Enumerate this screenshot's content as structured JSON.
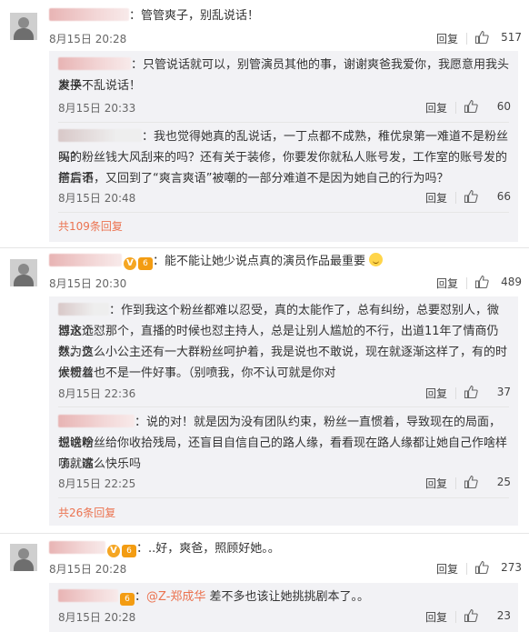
{
  "c1": {
    "text": "：管管爽子，别乱说话！",
    "time": "8月15日 20:28",
    "reply": "回复",
    "likes": "517",
    "replies": [
      {
        "lines": [
          "：只管说话就可以，别管演员其他的事，谢谢爽爸我爱你，我愿意用我头发换",
          "爽子不乱说话！"
        ],
        "time": "8月15日 20:33",
        "reply": "回复",
        "likes": "60"
      },
      {
        "lines": [
          "：我也觉得她真的乱说话，一丁点都不成熟，稚优泉第一难道不是粉丝买的",
          "吗？粉丝钱大风刮来的吗？还有关于装修，你要发你就私人账号发，工作室的账号发的前言不",
          "搭后语，又回到了“爽言爽语”被嘲的一部分难道不是因为她自己的行为吗？"
        ],
        "time": "8月15日 20:48",
        "reply": "回复",
        "likes": "66"
      }
    ],
    "more": "共109条回复"
  },
  "c2": {
    "text": "：能不能让她少说点真的演员作品最重要",
    "time": "8月15日 20:30",
    "reply": "回复",
    "likes": "489",
    "replies": [
      {
        "lines": [
          "：作到我这个粉丝都难以忍受，真的太能作了，总有纠纷，总要怼别人，微博永远",
          "怼这个怼那个，直播的时候也怼主持人，总是让别人尴尬的不行，出道11年了情商仍然为负",
          "数。这么小公主还有一大群粉丝呵护着，我是说也不敢说，现在就逐渐这样了，有的时候粉丝",
          "太惯着也不是一件好事。（别喷我，你不认可就是你对"
        ],
        "time": "8月15日 22:36",
        "reply": "回复",
        "likes": "37"
      },
      {
        "lines": [
          "：说的对！就是因为没有团队约束，粉丝一直惯着，导致现在的局面，想说啥",
          "说啥粉丝给你收拾残局，还盲目自信自己的路人缘，看看现在路人缘都让她自己作啥样了。嘴",
          "嗨就这么快乐吗"
        ],
        "time": "8月15日 22:25",
        "reply": "回复",
        "likes": "25"
      }
    ],
    "more": "共26条回复"
  },
  "c3": {
    "text": "：..好，爽爸，照顾好她。。",
    "time": "8月15日 20:28",
    "reply": "回复",
    "likes": "273",
    "replies": [
      {
        "mention": "@Z-郑成华",
        "text": " 差不多也该让她挑挑剧本了。。",
        "time": "8月15日 20:28",
        "reply": "回复",
        "likes": "23"
      }
    ]
  },
  "badge_v": "V",
  "badge_lv": "6",
  "colors": {
    "accent": "#eb7350",
    "reply_bg": "#f2f2f5"
  },
  "icons": {
    "like": "thumbs-up-icon",
    "emoji": "emoji-icon",
    "verified": "verified-badge-icon"
  }
}
